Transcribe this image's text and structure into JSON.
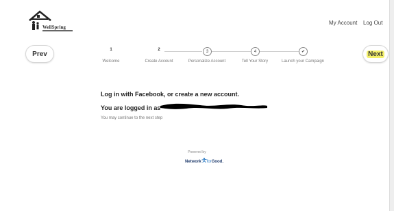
{
  "header": {
    "logo_text": "WellSpring",
    "my_account_label": "My Account",
    "logout_label": "Log Out"
  },
  "nav": {
    "prev_label": "Prev",
    "next_label": "Next"
  },
  "steps": [
    {
      "number": "1",
      "label": "Welcome"
    },
    {
      "number": "2",
      "label": "Create Account"
    },
    {
      "number": "3",
      "label": "Personalize Account"
    },
    {
      "number": "4",
      "label": "Tell Your Story"
    },
    {
      "number": "✔",
      "label": "Launch your Campaign"
    }
  ],
  "main": {
    "headline": "Log in with Facebook, or create a new account.",
    "logged_in_prefix": "You are logged in as",
    "continue_text": "You may continue to the next step"
  },
  "footer": {
    "powered_by": "Powered by",
    "brand_network": "Network",
    "brand_for": "for",
    "brand_good": "Good."
  },
  "colors": {
    "next_highlight": "#f4f06a",
    "nfg_navy": "#1f3a6b",
    "nfg_blue": "#2f7cc4"
  }
}
